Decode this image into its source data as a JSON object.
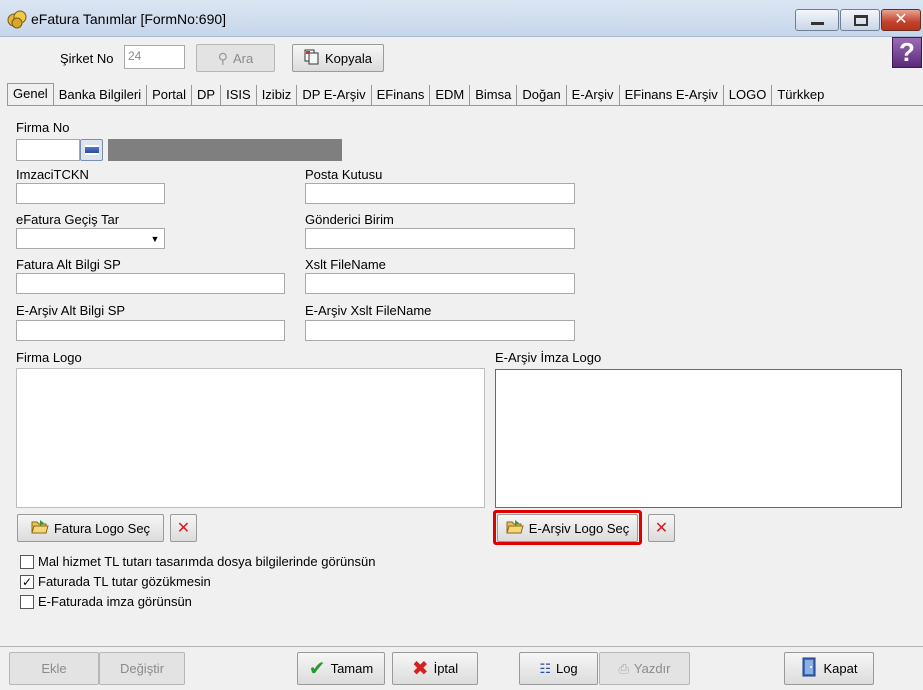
{
  "window": {
    "title": "eFatura Tanımlar [FormNo:690]",
    "help_label": "?"
  },
  "toolbar": {
    "sirket_label": "Şirket No",
    "sirket_value": "24",
    "search_label": "Ara",
    "copy_label": "Kopyala"
  },
  "tabs": [
    "Genel",
    "Banka Bilgileri",
    "Portal",
    "DP",
    "ISIS",
    "Izibiz",
    "DP E-Arşiv",
    "EFinans",
    "EDM",
    "Bimsa",
    "Doğan",
    "E-Arşiv",
    "EFinans E-Arşiv",
    "LOGO",
    "Türkkep"
  ],
  "form": {
    "firma_no_label": "Firma No",
    "imzaci_label": "ImzaciTCKN",
    "posta_label": "Posta Kutusu",
    "gecis_label": "eFatura Geçiş Tar",
    "gonderici_label": "Gönderici Birim",
    "alt_bilgi_label": "Fatura Alt Bilgi SP",
    "xslt_label": "Xslt FileName",
    "earsiv_alt_label": "E-Arşiv Alt Bilgi SP",
    "earsiv_xslt_label": "E-Arşiv Xslt FileName",
    "firma_logo_label": "Firma Logo",
    "imza_logo_label": "E-Arşiv İmza Logo",
    "fatura_logo_btn": "Fatura Logo Seç",
    "earsiv_logo_btn": "E-Arşiv Logo Seç"
  },
  "checkboxes": [
    {
      "label": "Mal hizmet TL tutarı tasarımda dosya bilgilerinde görünsün",
      "checked": false
    },
    {
      "label": "Faturada TL tutar gözükmesin",
      "checked": true
    },
    {
      "label": "E-Faturada imza görünsün",
      "checked": false
    }
  ],
  "bottom": {
    "ekle": "Ekle",
    "degistir": "Değiştir",
    "tamam": "Tamam",
    "iptal": "İptal",
    "log": "Log",
    "yazdir": "Yazdır",
    "kapat": "Kapat"
  },
  "colors": {
    "highlight": "#e00000",
    "titlebar": "#c6d6ea"
  }
}
